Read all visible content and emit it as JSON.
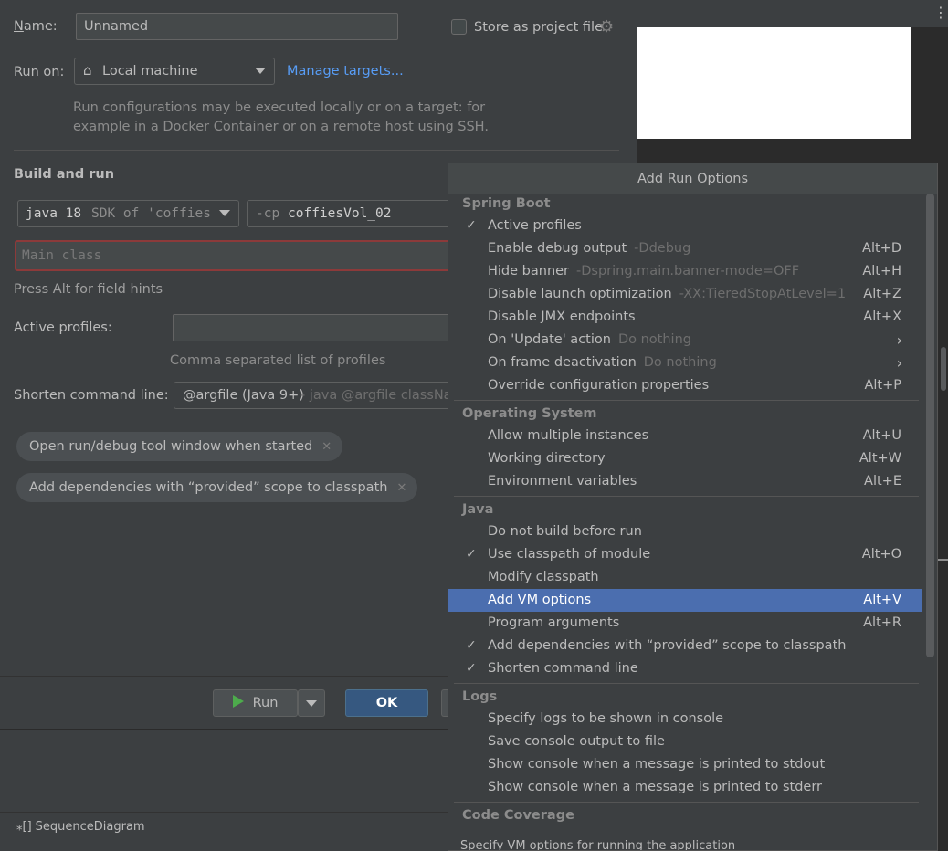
{
  "dialog": {
    "name_label": "Name:",
    "name_value": "Unnamed",
    "store_label": "Store as project file",
    "run_on_label": "Run on:",
    "run_on_value": "Local machine",
    "manage_targets": "Manage targets...",
    "run_on_hint_1": "Run configurations may be executed locally or on a target: for",
    "run_on_hint_2": "example in a Docker Container or on a remote host using SSH.",
    "build_title": "Build and run",
    "jdk_main": "java 18",
    "jdk_rest": "SDK of 'coffies",
    "cp_prefix": "-cp",
    "cp_value": "coffiesVol_02",
    "main_class_placeholder": "Main class",
    "field_hints": "Press Alt for field hints",
    "active_profiles_label": "Active profiles:",
    "active_profiles_hint": "Comma separated list of profiles",
    "shorten_label": "Shorten command line:",
    "shorten_value": "@argfile (Java 9+)",
    "shorten_hint": "- java @argfile classNar",
    "chip_1": "Open run/debug tool window when started",
    "chip_2": "Add dependencies with “provided” scope to classpath",
    "run_button": "Run",
    "ok_button": "OK"
  },
  "status": {
    "sequence_diagram": "SequenceDiagram"
  },
  "popup": {
    "title": "Add Run Options",
    "groups": {
      "spring_boot": "Spring Boot",
      "os": "Operating System",
      "java": "Java",
      "logs": "Logs",
      "coverage": "Code Coverage"
    },
    "items": {
      "active_profiles": "Active profiles",
      "debug_output": "Enable debug output",
      "debug_output_sub": "-Ddebug",
      "debug_output_sc": "Alt+D",
      "hide_banner": "Hide banner",
      "hide_banner_sub": "-Dspring.main.banner-mode=OFF",
      "hide_banner_sc": "Alt+H",
      "disable_launch": "Disable launch optimization",
      "disable_launch_sub": "-XX:TieredStopAtLevel=1",
      "disable_launch_sc": "Alt+Z",
      "disable_jmx": "Disable JMX endpoints",
      "disable_jmx_sc": "Alt+X",
      "on_update": "On 'Update' action",
      "on_update_sub": "Do nothing",
      "on_frame": "On frame deactivation",
      "on_frame_sub": "Do nothing",
      "override_props": "Override configuration properties",
      "override_props_sc": "Alt+P",
      "multiple_instances": "Allow multiple instances",
      "multiple_instances_sc": "Alt+U",
      "working_dir": "Working directory",
      "working_dir_sc": "Alt+W",
      "env_vars": "Environment variables",
      "env_vars_sc": "Alt+E",
      "no_build": "Do not build before run",
      "use_classpath": "Use classpath of module",
      "use_classpath_sc": "Alt+O",
      "modify_classpath": "Modify classpath",
      "vm_options": "Add VM options",
      "vm_options_sc": "Alt+V",
      "program_args": "Program arguments",
      "program_args_sc": "Alt+R",
      "provided_scope": "Add dependencies with “provided” scope to classpath",
      "shorten_cmd": "Shorten command line",
      "logs_console": "Specify logs to be shown in console",
      "save_output": "Save console output to file",
      "console_stdout": "Show console when a message is printed to stdout",
      "console_stderr": "Show console when a message is printed to stderr"
    },
    "footer": "Specify VM options for running the application"
  },
  "colors": {
    "background": "#3c3f41",
    "selection": "#4b6eaf",
    "link": "#589df6",
    "ok_button": "#365880",
    "error_border": "#8c3a3a"
  },
  "icons": {
    "home": "home-icon",
    "gear": "gear-icon",
    "check": "check-icon",
    "chevron": "chevron-right-icon",
    "close": "close-icon",
    "run": "run-icon"
  }
}
